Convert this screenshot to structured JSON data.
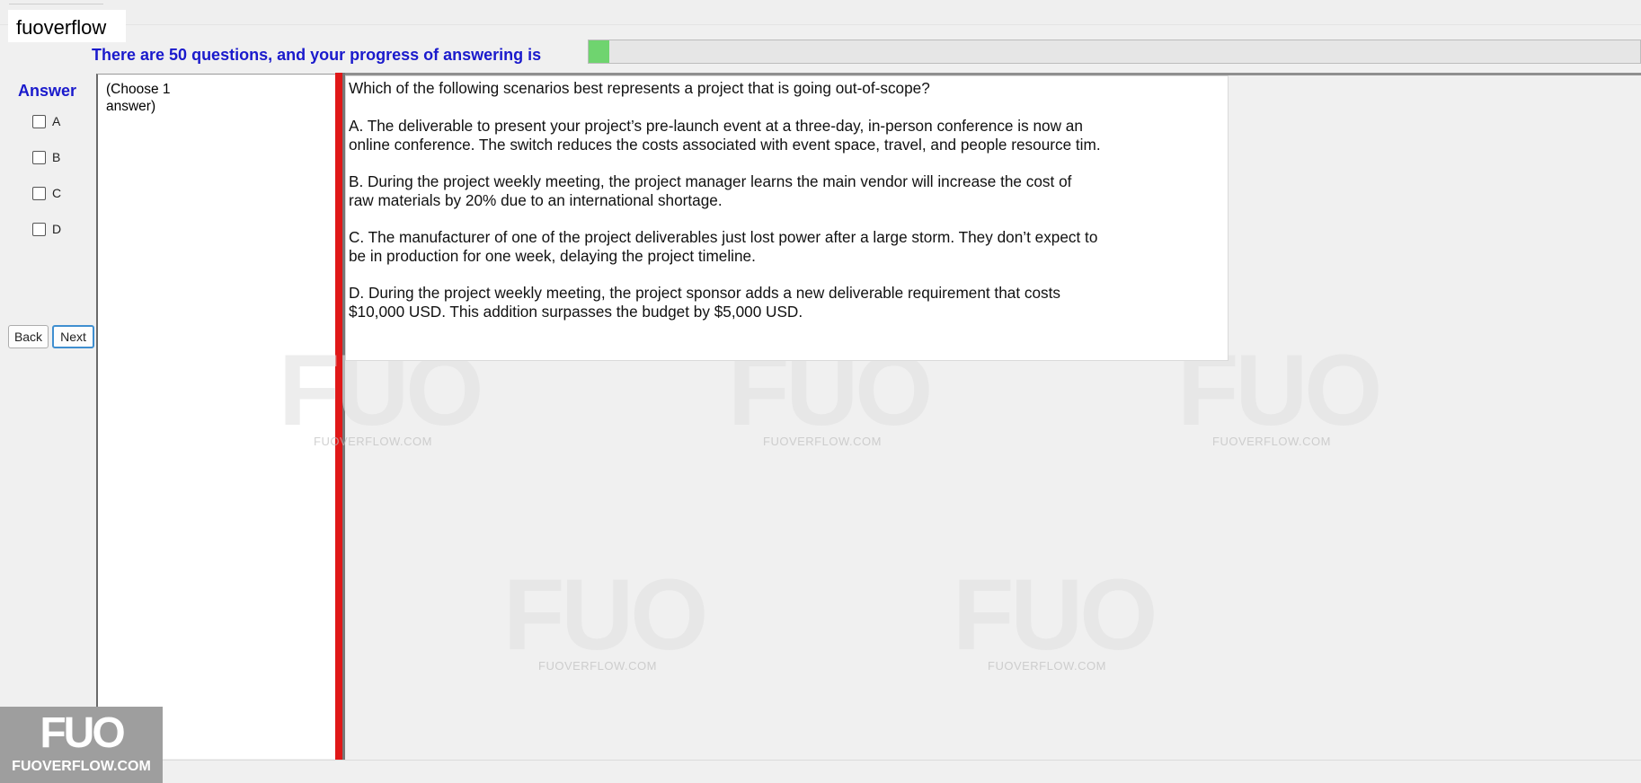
{
  "header": {
    "site_name": "fuoverflow",
    "progress_text": "There are 50 questions, and your progress of answering is",
    "progress_fraction": 0.02
  },
  "answer_panel": {
    "title": "Answer",
    "options": [
      "A",
      "B",
      "C",
      "D"
    ]
  },
  "navigation": {
    "back_label": "Back",
    "next_label": "Next"
  },
  "instruction": "(Choose 1 answer)",
  "question": {
    "text": "Which of the following scenarios best represents a project that is going out-of-scope?",
    "choices": [
      "A.  The deliverable to present your project’s pre-launch event at a three-day, in-person conference is now an\nonline conference. The switch reduces the costs associated with event space, travel, and people resource tim.",
      "B.  During the project weekly meeting, the project manager learns the main vendor will increase the cost of\nraw materials by 20% due to an international shortage.",
      "C.  The manufacturer of one of the project deliverables just lost power after a large storm. They don’t expect to\nbe in production for one week, delaying the project timeline.",
      "D.  During the project weekly meeting, the project sponsor adds a new deliverable requirement that costs\n$10,000 USD. This addition surpasses the budget by $5,000 USD."
    ]
  },
  "watermark": {
    "mark": "FUO",
    "text": "FUOVERFLOW.COM"
  },
  "logo": {
    "mark": "FUO",
    "text": "FUOVERFLOW.COM"
  }
}
